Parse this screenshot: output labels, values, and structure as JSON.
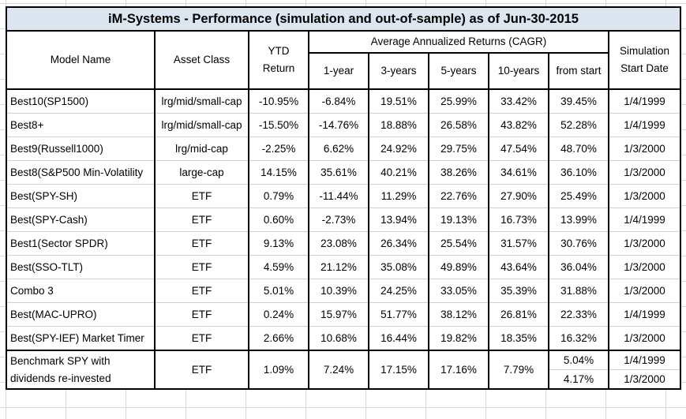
{
  "title": "iM-Systems - Performance (simulation and out-of-sample) as of  Jun-30-2015",
  "headers": {
    "model_name": "Model Name",
    "asset_class": "Asset Class",
    "ytd_return": "YTD Return",
    "cagr_group": "Average Annualized Returns (CAGR)",
    "one_year": "1-year",
    "three_years": "3-years",
    "five_years": "5-years",
    "ten_years": "10-years",
    "from_start": "from start",
    "sim_start_date": "Simulation Start Date"
  },
  "rows": [
    {
      "model": "Best10(SP1500)",
      "asset": "lrg/mid/small-cap",
      "ytd": "-10.95%",
      "y1": "-6.84%",
      "y3": "19.51%",
      "y5": "25.99%",
      "y10": "33.42%",
      "start": "39.45%",
      "date": "1/4/1999"
    },
    {
      "model": "Best8+",
      "asset": "lrg/mid/small-cap",
      "ytd": "-15.50%",
      "y1": "-14.76%",
      "y3": "18.88%",
      "y5": "26.58%",
      "y10": "43.82%",
      "start": "52.28%",
      "date": "1/4/1999"
    },
    {
      "model": "Best9(Russell1000)",
      "asset": "lrg/mid-cap",
      "ytd": "-2.25%",
      "y1": "6.62%",
      "y3": "24.92%",
      "y5": "29.75%",
      "y10": "47.54%",
      "start": "48.70%",
      "date": "1/3/2000"
    },
    {
      "model": "Best8(S&P500 Min-Volatility",
      "asset": "large-cap",
      "ytd": "14.15%",
      "y1": "35.61%",
      "y3": "40.21%",
      "y5": "38.26%",
      "y10": "34.61%",
      "start": "36.10%",
      "date": "1/3/2000"
    },
    {
      "model": "Best(SPY-SH)",
      "asset": "ETF",
      "ytd": "0.79%",
      "y1": "-11.44%",
      "y3": "11.29%",
      "y5": "22.76%",
      "y10": "27.90%",
      "start": "25.49%",
      "date": "1/3/2000"
    },
    {
      "model": "Best(SPY-Cash)",
      "asset": "ETF",
      "ytd": "0.60%",
      "y1": "-2.73%",
      "y3": "13.94%",
      "y5": "19.13%",
      "y10": "16.73%",
      "start": "13.99%",
      "date": "1/4/1999"
    },
    {
      "model": "Best1(Sector SPDR)",
      "asset": "ETF",
      "ytd": "9.13%",
      "y1": "23.08%",
      "y3": "26.34%",
      "y5": "25.54%",
      "y10": "31.57%",
      "start": "30.76%",
      "date": "1/3/2000"
    },
    {
      "model": "Best(SSO-TLT)",
      "asset": "ETF",
      "ytd": "4.59%",
      "y1": "21.12%",
      "y3": "35.08%",
      "y5": "49.89%",
      "y10": "43.64%",
      "start": "36.04%",
      "date": "1/3/2000"
    },
    {
      "model": "Combo 3",
      "asset": "ETF",
      "ytd": "5.01%",
      "y1": "10.39%",
      "y3": "24.25%",
      "y5": "33.05%",
      "y10": "35.39%",
      "start": "31.88%",
      "date": "1/3/2000"
    },
    {
      "model": "Best(MAC-UPRO)",
      "asset": "ETF",
      "ytd": "0.24%",
      "y1": "15.97%",
      "y3": "51.77%",
      "y5": "38.12%",
      "y10": "26.81%",
      "start": "22.33%",
      "date": "1/4/1999"
    },
    {
      "model": "Best(SPY-IEF) Market Timer",
      "asset": "ETF",
      "ytd": "2.66%",
      "y1": "10.68%",
      "y3": "16.44%",
      "y5": "19.82%",
      "y10": "18.35%",
      "start": "16.32%",
      "date": "1/3/2000"
    }
  ],
  "benchmark": {
    "model": "Benchmark SPY with dividends re-invested",
    "asset": "ETF",
    "ytd": "1.09%",
    "y1": "7.24%",
    "y3": "17.15%",
    "y5": "17.16%",
    "y10": "7.79%",
    "starts": [
      {
        "start": "5.04%",
        "date": "1/4/1999"
      },
      {
        "start": "4.17%",
        "date": "1/3/2000"
      }
    ]
  }
}
